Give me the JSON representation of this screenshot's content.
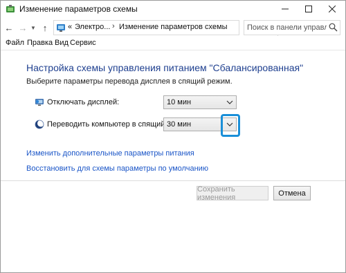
{
  "window": {
    "title": "Изменение параметров схемы"
  },
  "address_bar": {
    "crumb_root": "«",
    "crumb_1": "Электро...",
    "crumb_2": "Изменение параметров схемы",
    "search_placeholder": "Поиск в панели управления"
  },
  "menu": {
    "items": [
      "Файл",
      "Правка",
      "Вид",
      "Сервис"
    ]
  },
  "content": {
    "heading": "Настройка схемы управления питанием \"Сбалансированная\"",
    "subtitle": "Выберите параметры перевода дисплея в спящий режим.",
    "display_off_label": "Отключать дисплей:",
    "display_off_value": "10 мин",
    "sleep_label": "Переводить компьютер в спящий режим:",
    "sleep_value": "30 мин",
    "link_advanced": "Изменить дополнительные параметры питания",
    "link_restore": "Восстановить для схемы параметры по умолчанию"
  },
  "buttons": {
    "save": "Сохранить изменения",
    "cancel": "Отмена"
  },
  "colors": {
    "heading": "#1e3f8f",
    "link": "#1a55c7",
    "highlight": "#1a8fd8"
  }
}
